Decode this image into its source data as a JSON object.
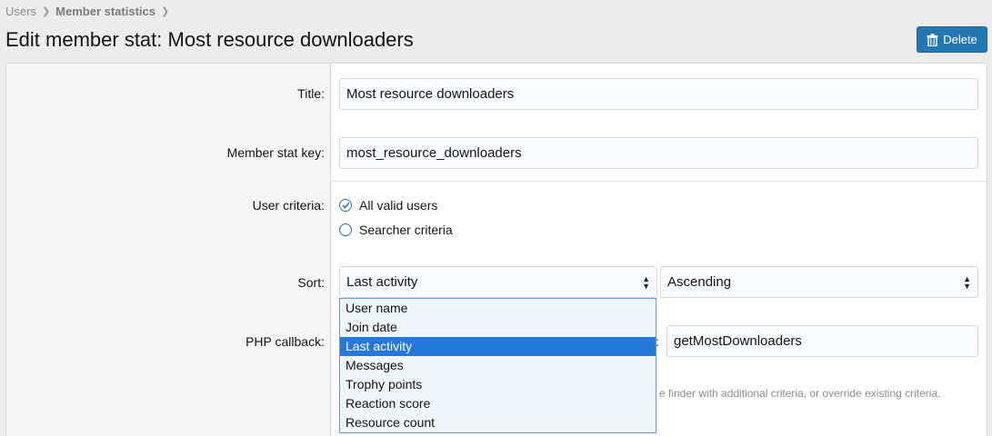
{
  "breadcrumb": {
    "item1": "Users",
    "item2": "Member statistics"
  },
  "page": {
    "title": "Edit member stat: Most resource downloaders"
  },
  "header": {
    "delete_label": "Delete"
  },
  "form": {
    "title_label": "Title:",
    "title_value": "Most resource downloaders",
    "key_label": "Member stat key:",
    "key_value": "most_resource_downloaders",
    "criteria_label": "User criteria:",
    "criteria_option1": "All valid users",
    "criteria_option2": "Searcher criteria",
    "sort_label": "Sort:",
    "sort_value": "Last activity",
    "direction_value": "Ascending",
    "php_label": "PHP callback:",
    "php_colon": ":",
    "php_method_value": "getMostDownloaders",
    "hint_text": "e finder with additional criteria, or override existing criteria."
  },
  "sort_options": [
    "User name",
    "Join date",
    "Last activity",
    "Messages",
    "Trophy points",
    "Reaction score",
    "Resource count"
  ],
  "colors": {
    "accent": "#2577b1",
    "selected_option": "#2577db"
  }
}
